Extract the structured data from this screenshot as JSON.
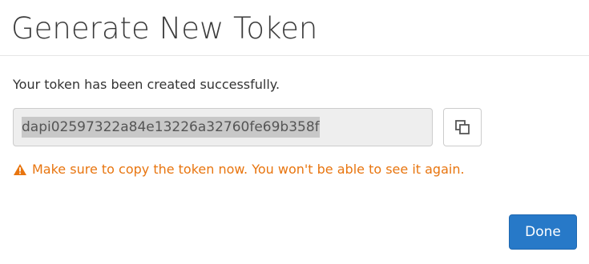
{
  "dialog": {
    "title": "Generate New Token",
    "success_message": "Your token has been created successfully.",
    "token_value": "dapi02597322a84e13226a32760fe69b358f",
    "copy_icon": "copy-icon",
    "warning_icon": "warning-triangle-icon",
    "warning_message": "Make sure to copy the token now. You won't be able to see it again.",
    "done_label": "Done"
  },
  "colors": {
    "warning": "#e8750f",
    "primary": "#2779c8"
  }
}
